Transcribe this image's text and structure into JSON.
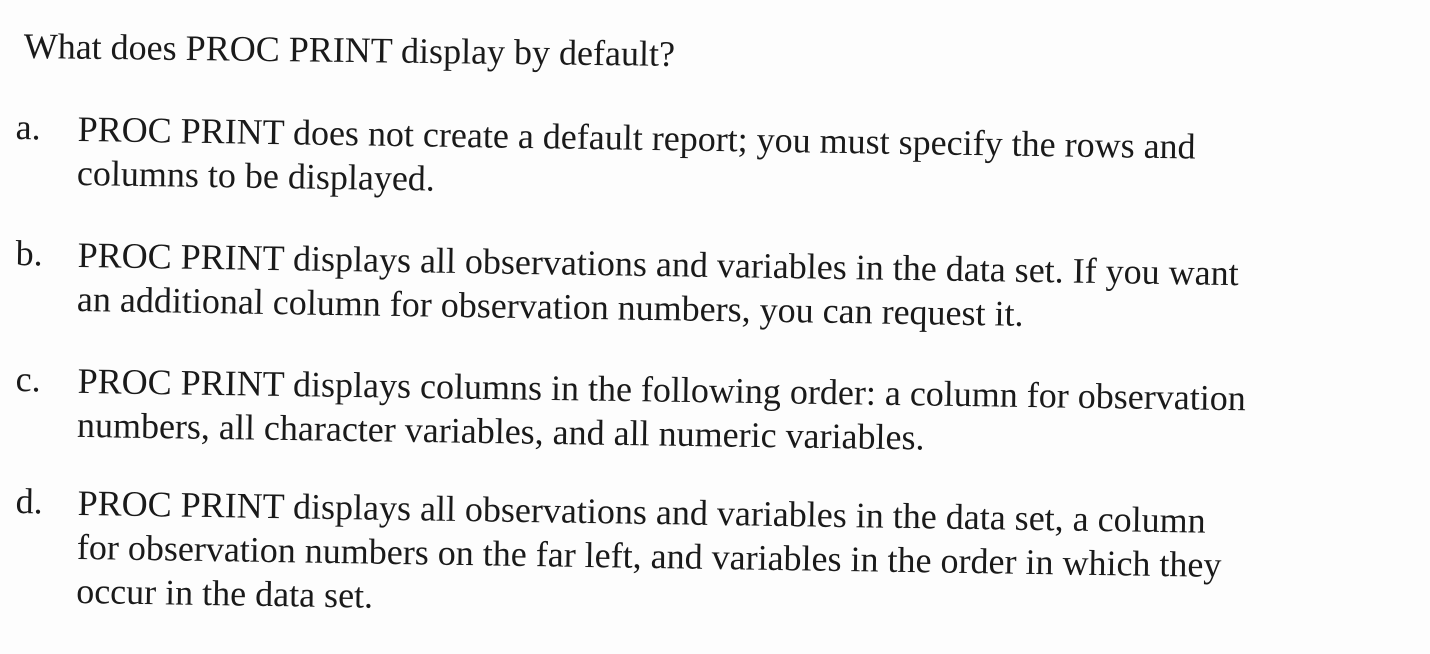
{
  "question": "What does PROC PRINT display by default?",
  "options": [
    {
      "letter": "a.",
      "lines": [
        "PROC PRINT does not create a default report; you must specify the rows and",
        "columns to be displayed."
      ]
    },
    {
      "letter": "b.",
      "lines": [
        "PROC PRINT displays all observations and variables in the data set. If you want",
        "an additional column for observation numbers, you can request it."
      ]
    },
    {
      "letter": "c.",
      "lines": [
        "PROC PRINT displays columns in the following order: a column for observation",
        "numbers, all character variables, and all numeric variables."
      ]
    },
    {
      "letter": "d.",
      "lines": [
        "PROC PRINT displays all observations and variables in the data set, a column",
        "for observation numbers on the far left, and variables in the order in which they",
        "occur in the data set."
      ]
    }
  ]
}
